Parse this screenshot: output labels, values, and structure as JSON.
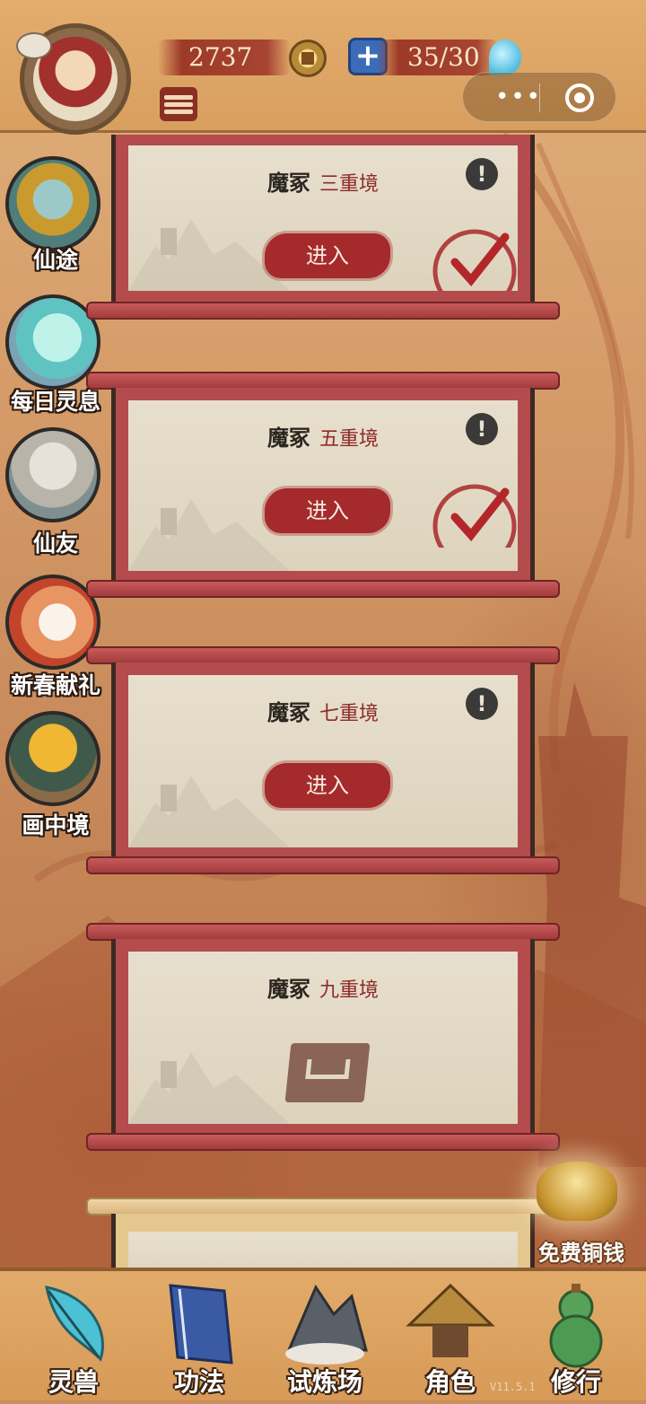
{
  "header": {
    "copper": "2737",
    "stamina": "35/30",
    "capsule_dots": "•••"
  },
  "side_menu": [
    {
      "label": "仙途",
      "icon": "pine-tree-icon"
    },
    {
      "label": "每日灵息",
      "icon": "spirit-mist-icon"
    },
    {
      "label": "仙友",
      "icon": "elder-avatar-icon"
    },
    {
      "label": "新春献礼",
      "icon": "rabbit-gift-icon"
    },
    {
      "label": "画中境",
      "icon": "golden-tree-pavilion-icon"
    }
  ],
  "stages": [
    {
      "name": "魔冢",
      "level": "三重境",
      "button": "进入",
      "status": "cleared"
    },
    {
      "name": "魔冢",
      "level": "五重境",
      "button": "进入",
      "status": "cleared"
    },
    {
      "name": "魔冢",
      "level": "七重境",
      "button": "进入",
      "status": "available"
    },
    {
      "name": "魔冢",
      "level": "九重境",
      "button": "",
      "status": "locked"
    }
  ],
  "info_glyph": "!",
  "free_coins": {
    "label": "免费铜钱"
  },
  "bottom_nav": [
    {
      "label": "灵兽",
      "icon": "feather-icon"
    },
    {
      "label": "功法",
      "icon": "book-icon"
    },
    {
      "label": "试炼场",
      "icon": "mountain-icon"
    },
    {
      "label": "角色",
      "icon": "straw-hat-icon"
    },
    {
      "label": "修行",
      "icon": "gourd-icon"
    }
  ],
  "version": "V11.5.1"
}
